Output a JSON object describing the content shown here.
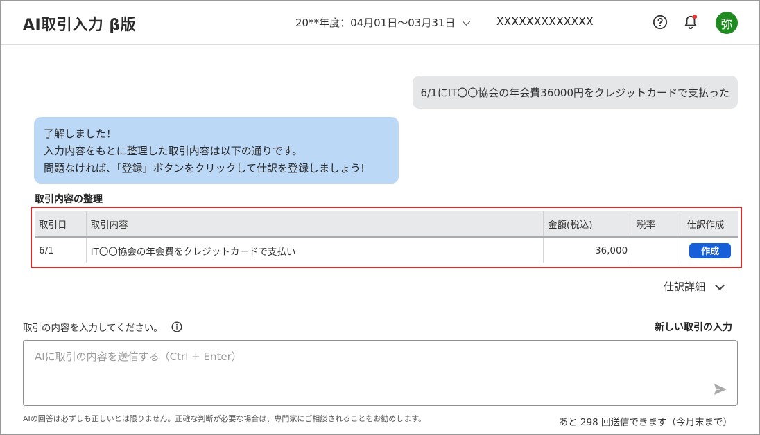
{
  "header": {
    "title": "AI取引入力 β版",
    "fiscal_period": "20**年度：04月01日〜03月31日",
    "company": "XXXXXXXXXXXXX",
    "avatar_initial": "弥",
    "notification_color": "#e53935",
    "avatar_color": "#1f8a1f"
  },
  "chat": {
    "user_message": "6/1にIT〇〇協会の年会費36000円をクレジットカードで支払った",
    "ai_lines": [
      "了解しました！",
      "入力内容をもとに整理した取引内容は以下の通りです。",
      "問題なければ、「登録」ボタンをクリックして仕訳を登録しましょう!"
    ]
  },
  "summary": {
    "title": "取引内容の整理",
    "columns": [
      "取引日",
      "取引内容",
      "金額(税込)",
      "税率",
      "仕訳作成"
    ],
    "rows": [
      {
        "date": "6/1",
        "description": "IT〇〇協会の年会費をクレジットカードで支払い",
        "amount": "36,000",
        "tax_rate": "",
        "action": "作成"
      }
    ],
    "highlight_color": "#d62d2d"
  },
  "detail_toggle_label": "仕訳詳細",
  "input": {
    "label": "取引の内容を入力してください。",
    "new_transaction": "新しい取引の入力",
    "placeholder": "AIに取引の内容を送信する（Ctrl + Enter）",
    "value": ""
  },
  "footer": {
    "disclaimer": "AIの回答は必ずしも正しいとは限りません。正確な判断が必要な場合は、専門家にご相談されることをお勧めします。",
    "remaining": "あと 298 回送信できます（今月末まで）"
  },
  "colors": {
    "button_blue": "#1560d8",
    "ai_bubble": "#bcd8f7",
    "user_bubble": "#e4e6e8"
  }
}
